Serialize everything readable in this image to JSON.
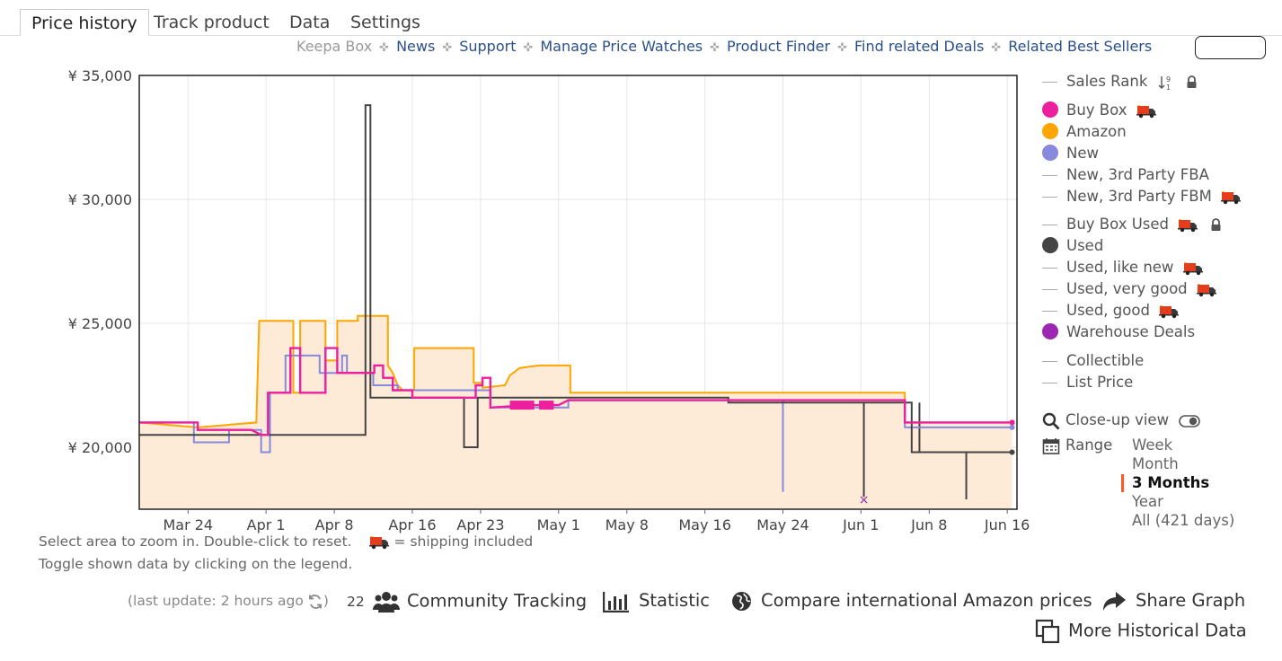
{
  "tabs": [
    {
      "label": "Price history",
      "active": true
    },
    {
      "label": "Track product"
    },
    {
      "label": "Data"
    },
    {
      "label": "Settings"
    }
  ],
  "links": {
    "keepa_box": "Keepa Box",
    "news": "News",
    "support": "Support",
    "manage_price_watches": "Manage Price Watches",
    "product_finder": "Product Finder",
    "find_related_deals": "Find related Deals",
    "related_best_sellers": "Related Best Sellers"
  },
  "legend": {
    "sales_rank": "Sales Rank",
    "buy_box": "Buy Box",
    "amazon": "Amazon",
    "new": "New",
    "new_3p_fba": "New, 3rd Party FBA",
    "new_3p_fbm": "New, 3rd Party FBM",
    "buy_box_used": "Buy Box Used",
    "used": "Used",
    "used_like_new": "Used, like new",
    "used_very_good": "Used, very good",
    "used_good": "Used, good",
    "warehouse_deals": "Warehouse Deals",
    "collectible": "Collectible",
    "list_price": "List Price"
  },
  "controls": {
    "close_up_view": "Close-up view",
    "range_label": "Range",
    "range_options": [
      "Week",
      "Month",
      "3 Months",
      "Year",
      "All (421 days)"
    ],
    "range_selected": "3 Months"
  },
  "notes": {
    "zoom_hint": "Select area to zoom in. Double-click to reset.",
    "shipping_hint": "= shipping included",
    "toggle_hint": "Toggle shown data by clicking on the legend."
  },
  "bottom": {
    "last_update": "(last update: 2 hours ago",
    "tracking_count": "22",
    "community_tracking": "Community Tracking",
    "statistic": "Statistic",
    "compare_prices": "Compare international Amazon prices",
    "share_graph": "Share Graph",
    "more_historical": "More Historical Data"
  },
  "colors": {
    "buy_box": "#ec1f9f",
    "amazon": "#ffa500",
    "new": "#8888dd",
    "used": "#444444",
    "warehouse": "#9c27b0",
    "fill": "#fdebd7",
    "accent": "#ff5722"
  },
  "chart_data": {
    "type": "line",
    "y_ticks": [
      "¥ 35,000",
      "¥ 30,000",
      "¥ 25,000",
      "¥ 20,000"
    ],
    "x_ticks": [
      "Mar 24",
      "Apr 1",
      "Apr 8",
      "Apr 16",
      "Apr 23",
      "May 1",
      "May 8",
      "May 16",
      "May 24",
      "Jun 1",
      "Jun 8",
      "Jun 16"
    ],
    "x_tick_days": [
      7,
      15,
      22,
      30,
      37,
      45,
      52,
      60,
      68,
      76,
      83,
      91
    ],
    "x_range_days": [
      2,
      92
    ],
    "ylim": [
      17500,
      35000
    ],
    "step": true,
    "series": [
      {
        "name": "Amazon",
        "key": "amazon",
        "fill": true,
        "points": [
          [
            2,
            21000
          ],
          [
            8,
            20800
          ],
          [
            14,
            21000
          ],
          [
            14.3,
            25100
          ],
          [
            17.8,
            25100
          ],
          [
            17.8,
            22200
          ],
          [
            18.5,
            22200
          ],
          [
            18.5,
            25100
          ],
          [
            21.1,
            25100
          ],
          [
            21.1,
            23500
          ],
          [
            22.3,
            23500
          ],
          [
            22.3,
            25100
          ],
          [
            24.4,
            25100
          ],
          [
            24.4,
            25300
          ],
          [
            27.5,
            25300
          ],
          [
            27.5,
            23300
          ],
          [
            28,
            23000
          ],
          [
            28.5,
            22500
          ],
          [
            29,
            22300
          ],
          [
            30.2,
            22300
          ],
          [
            30.2,
            24000
          ],
          [
            36.3,
            24000
          ],
          [
            36.3,
            22600
          ],
          [
            37.2,
            22600
          ],
          [
            37.2,
            22400
          ],
          [
            39.5,
            22500
          ],
          [
            40,
            22900
          ],
          [
            41,
            23200
          ],
          [
            43,
            23300
          ],
          [
            46.2,
            23300
          ],
          [
            46.2,
            22200
          ],
          [
            80.5,
            22200
          ],
          [
            80.5,
            21000
          ],
          [
            91.5,
            21000
          ]
        ]
      },
      {
        "name": "New",
        "key": "new",
        "points": [
          [
            2,
            21000
          ],
          [
            7.6,
            21000
          ],
          [
            7.6,
            20200
          ],
          [
            11.2,
            20200
          ],
          [
            11.2,
            20700
          ],
          [
            14.5,
            20700
          ],
          [
            14.5,
            19800
          ],
          [
            15.4,
            19800
          ],
          [
            15.4,
            22200
          ],
          [
            17,
            22200
          ],
          [
            17,
            23700
          ],
          [
            20.5,
            23700
          ],
          [
            20.5,
            23000
          ],
          [
            22.8,
            23000
          ],
          [
            22.8,
            23700
          ],
          [
            23.3,
            23700
          ],
          [
            23.3,
            23000
          ],
          [
            26,
            23000
          ],
          [
            26,
            22500
          ],
          [
            28.5,
            22500
          ],
          [
            28.5,
            22300
          ],
          [
            38,
            22300
          ],
          [
            38,
            21600
          ],
          [
            46,
            21600
          ],
          [
            46,
            21900
          ],
          [
            80.5,
            21900
          ],
          [
            80.5,
            20800
          ],
          [
            91.5,
            20800
          ]
        ]
      },
      {
        "name": "Buy Box",
        "key": "buy_box",
        "points": [
          [
            2,
            21000
          ],
          [
            8,
            21000
          ],
          [
            8,
            20700
          ],
          [
            13.5,
            20700
          ],
          [
            14.5,
            20500
          ],
          [
            15.2,
            20500
          ],
          [
            15.2,
            22200
          ],
          [
            17.5,
            22200
          ],
          [
            17.5,
            24000
          ],
          [
            18.5,
            24000
          ],
          [
            18.5,
            22200
          ],
          [
            21.1,
            22200
          ],
          [
            21.1,
            24000
          ],
          [
            22.3,
            24000
          ],
          [
            22.3,
            23000
          ],
          [
            26.1,
            23000
          ],
          [
            26.1,
            23300
          ],
          [
            27,
            23300
          ],
          [
            27,
            22800
          ],
          [
            28,
            22800
          ],
          [
            28,
            22300
          ],
          [
            30,
            22300
          ],
          [
            30,
            22000
          ],
          [
            36.5,
            22000
          ],
          [
            36.5,
            22500
          ],
          [
            37.2,
            22500
          ],
          [
            37.2,
            22800
          ],
          [
            38,
            22800
          ],
          [
            38,
            21600
          ],
          [
            42,
            21700
          ],
          [
            45,
            21700
          ],
          [
            46,
            21900
          ],
          [
            80.5,
            21900
          ],
          [
            80.5,
            21000
          ],
          [
            91.5,
            21000
          ]
        ]
      },
      {
        "name": "Used",
        "key": "used",
        "points": [
          [
            2,
            20500
          ],
          [
            25.2,
            20500
          ],
          [
            25.2,
            33800
          ],
          [
            25.7,
            33800
          ],
          [
            25.7,
            22000
          ],
          [
            35.3,
            22000
          ],
          [
            35.3,
            20000
          ],
          [
            36.7,
            20000
          ],
          [
            36.7,
            22000
          ],
          [
            62.4,
            22000
          ],
          [
            62.4,
            21800
          ],
          [
            81.2,
            21800
          ],
          [
            81.2,
            19800
          ],
          [
            91.5,
            19800
          ]
        ]
      }
    ],
    "spikes": [
      {
        "key": "used",
        "x": 76.3,
        "from": 21800,
        "to": 18000
      },
      {
        "key": "used",
        "x": 82,
        "from": 21800,
        "to": 19800
      },
      {
        "key": "used",
        "x": 86.8,
        "from": 19800,
        "to": 17900
      },
      {
        "key": "new",
        "x": 68,
        "from": 21900,
        "to": 18200
      }
    ],
    "warehouse_point": [
      76.3,
      17900
    ],
    "buy_box_dense": [
      [
        40,
        42.5,
        21700
      ],
      [
        43,
        44.5,
        21700
      ]
    ]
  }
}
